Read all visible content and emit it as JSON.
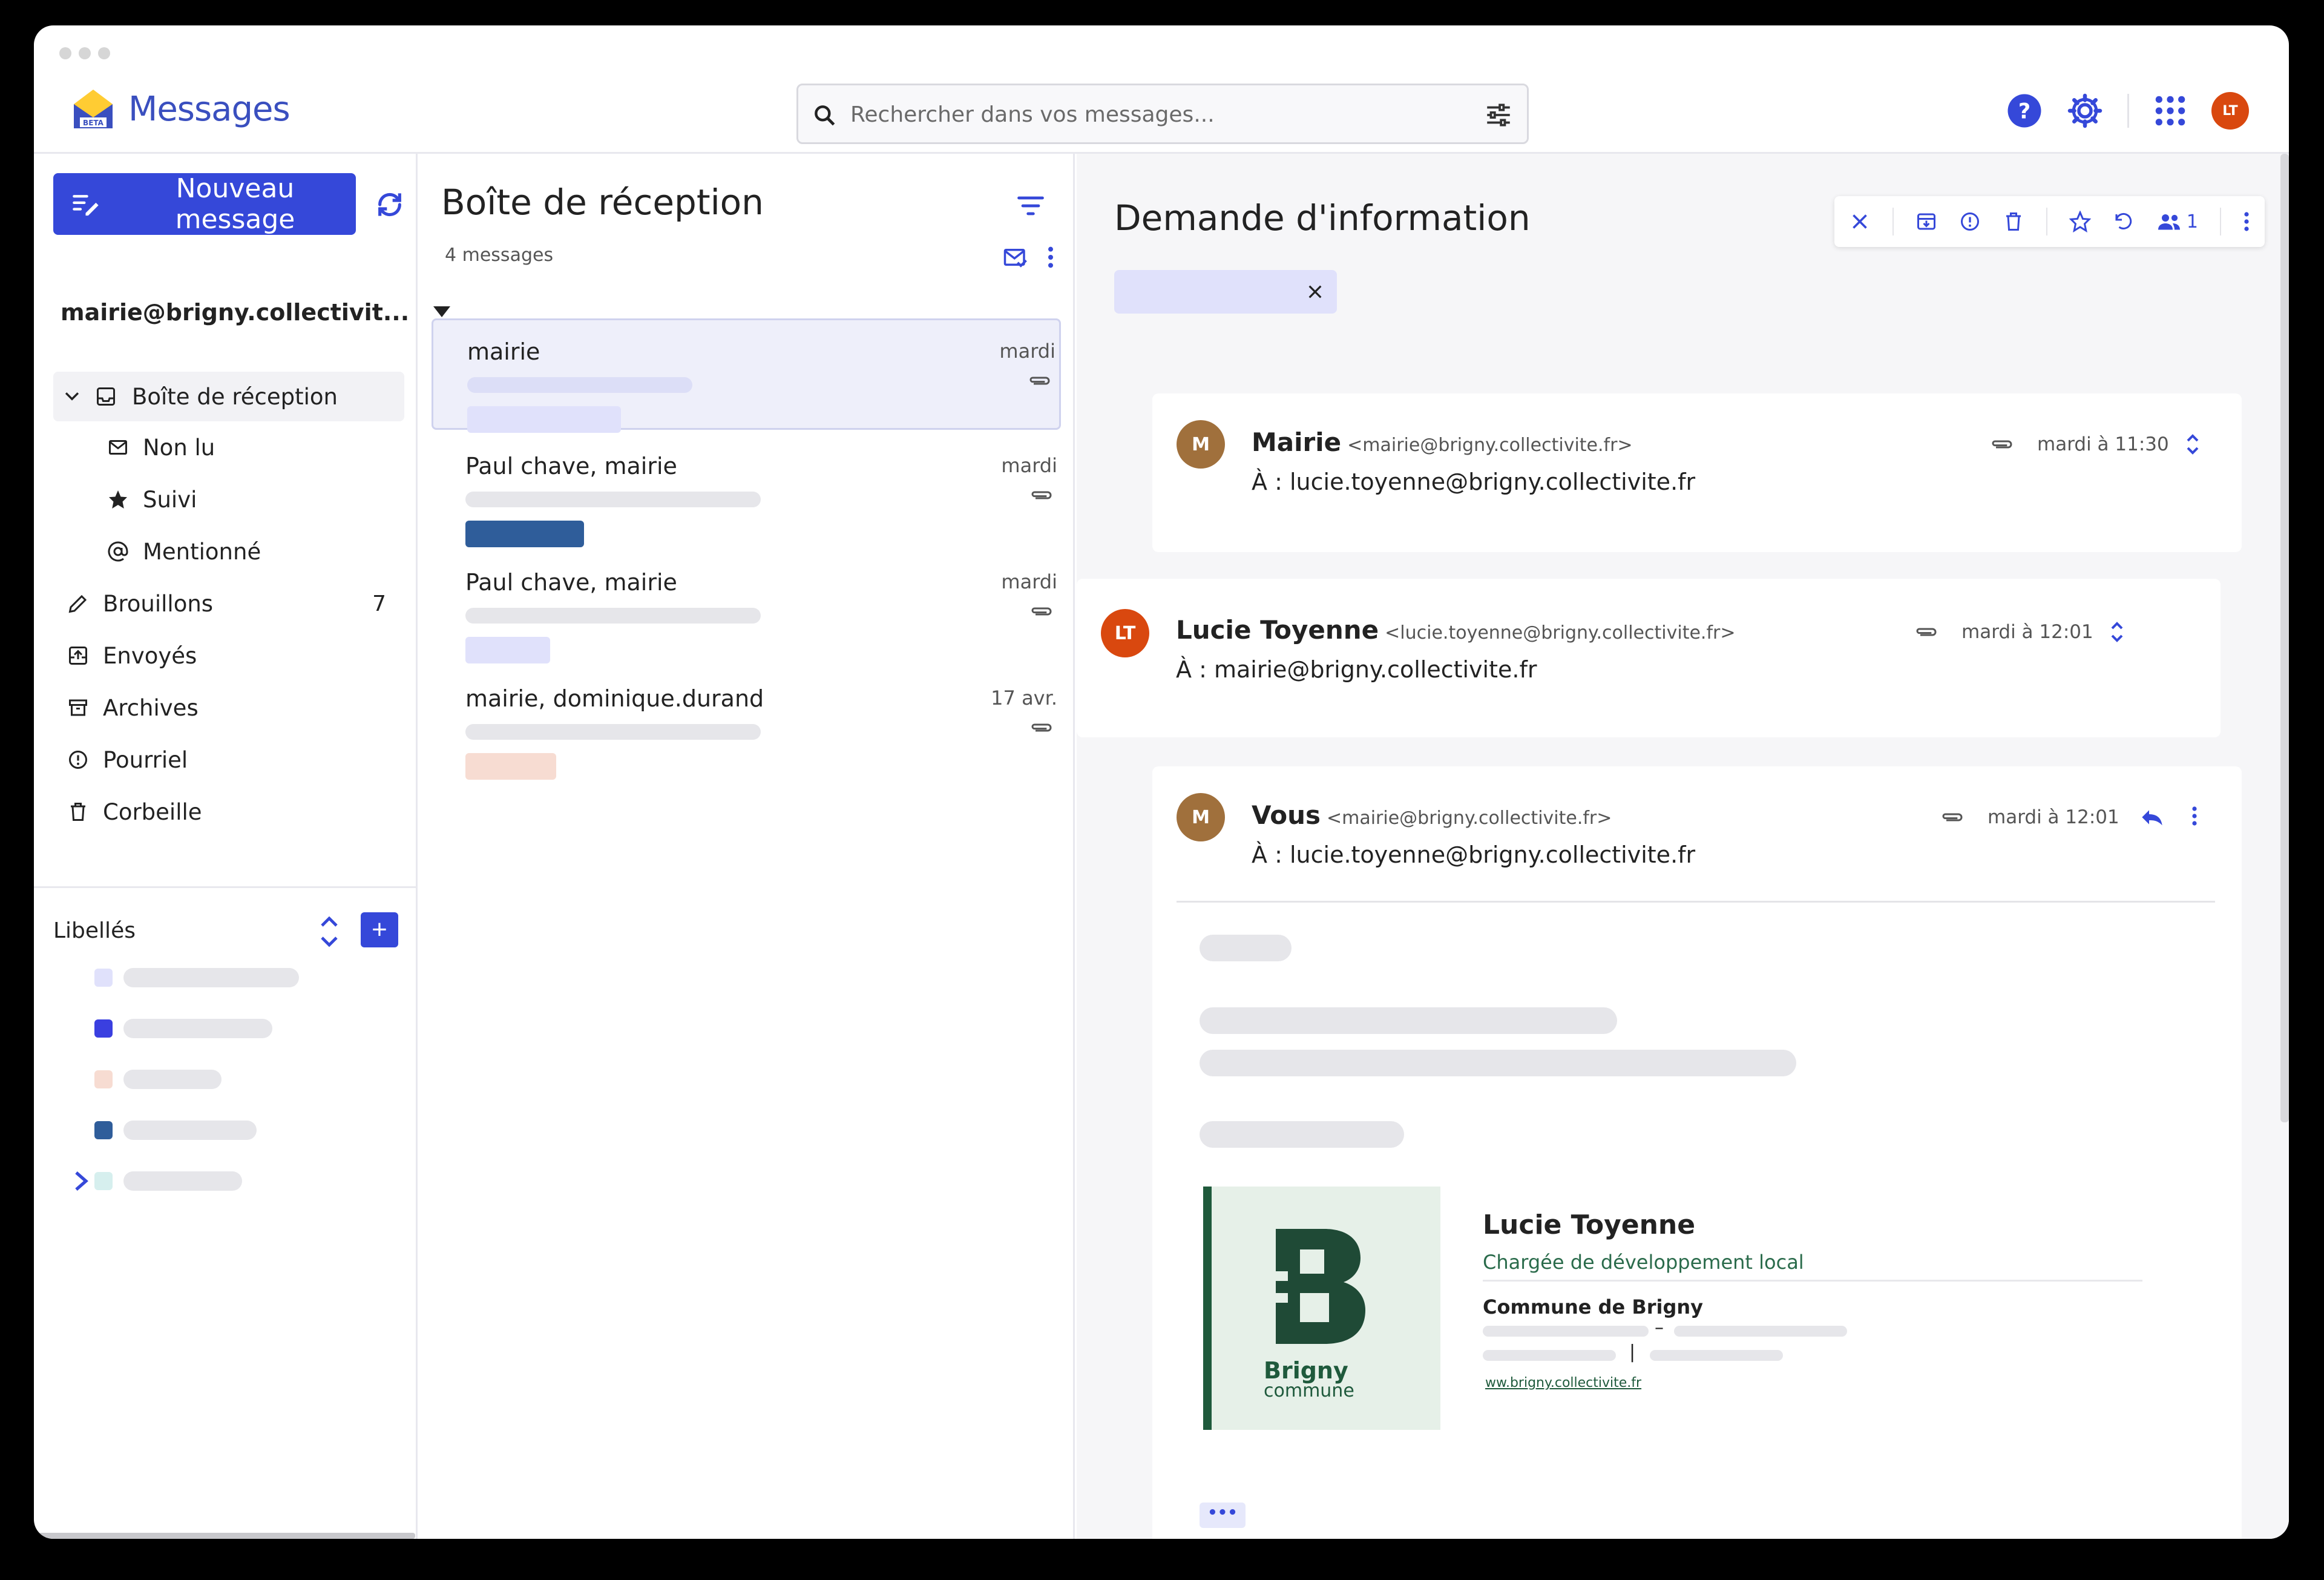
{
  "app": {
    "title": "Messages",
    "badge": "BETA"
  },
  "search": {
    "placeholder": "Rechercher dans vos messages..."
  },
  "user": {
    "initials": "LT"
  },
  "sidebar": {
    "new_message": "Nouveau message",
    "account": "mairie@brigny.collectivit...",
    "items": [
      {
        "label": "Boîte de réception",
        "icon": "inbox-icon"
      },
      {
        "label": "Non lu",
        "icon": "unread-mail-icon"
      },
      {
        "label": "Suivi",
        "icon": "star-icon"
      },
      {
        "label": "Mentionné",
        "icon": "at-icon"
      },
      {
        "label": "Brouillons",
        "icon": "pencil-icon",
        "count": "7"
      },
      {
        "label": "Envoyés",
        "icon": "sent-icon"
      },
      {
        "label": "Archives",
        "icon": "archive-icon"
      },
      {
        "label": "Pourriel",
        "icon": "spam-icon"
      },
      {
        "label": "Corbeille",
        "icon": "trash-icon"
      }
    ],
    "labels_title": "Libellés",
    "label_colors": [
      "#e0e1fb",
      "#3a3fe0",
      "#f7dcd2",
      "#2f5d9a",
      "#d6efee"
    ]
  },
  "list": {
    "title": "Boîte de réception",
    "count": "4 messages",
    "messages": [
      {
        "from": "mairie",
        "date": "mardi",
        "tag_color": "#e0e1fb"
      },
      {
        "from": "Paul chave, mairie",
        "date": "mardi",
        "tag_color": "#2f5d9a"
      },
      {
        "from": "Paul chave, mairie",
        "date": "mardi",
        "tag_color": "#e0e1fb"
      },
      {
        "from": "mairie, dominique.durand",
        "date": "17 avr.",
        "tag_color": "#f7dcd2"
      }
    ]
  },
  "thread": {
    "title": "Demande d'information",
    "participants_count": "1",
    "messages": [
      {
        "initial": "M",
        "name": "Mairie",
        "address": "<mairie@brigny.collectivite.fr>",
        "to_label": "À :",
        "to": "lucie.toyenne@brigny.collectivite.fr",
        "time": "mardi à 11:30",
        "avatar_color": "#a0703c"
      },
      {
        "initial": "LT",
        "name": "Lucie Toyenne",
        "address": "<lucie.toyenne@brigny.collectivite.fr>",
        "to_label": "À :",
        "to": "mairie@brigny.collectivite.fr",
        "time": "mardi à 12:01",
        "avatar_color": "#d9480f"
      },
      {
        "initial": "M",
        "name": "Vous",
        "address": "<mairie@brigny.collectivite.fr>",
        "to_label": "À :",
        "to": "lucie.toyenne@brigny.collectivite.fr",
        "time": "mardi à 12:01",
        "avatar_color": "#a0703c"
      }
    ],
    "signature": {
      "name": "Lucie Toyenne",
      "role": "Chargée de développement local",
      "org": "Commune de Brigny",
      "link": "ww.brigny.collectivite.fr",
      "logo_line1": "Brigny",
      "logo_line2": "commune"
    },
    "more_label": "•••"
  },
  "colors": {
    "accent": "#3548d9",
    "brand_green": "#1f5a3c"
  }
}
